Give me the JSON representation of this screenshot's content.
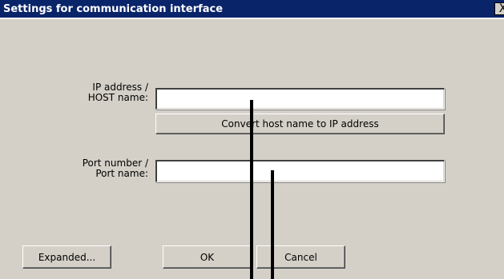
{
  "window": {
    "title": "Settings for communication interface",
    "close_glyph": "X"
  },
  "ip_field": {
    "label_line1": "IP address /",
    "label_line2": "HOST name:",
    "value": ""
  },
  "convert_button": {
    "label": "Convert host name to IP address"
  },
  "port_field": {
    "label_line1": "Port number /",
    "label_line2": "Port name:",
    "value": ""
  },
  "buttons": {
    "expanded": "Expanded...",
    "ok": "OK",
    "cancel": "Cancel"
  },
  "colors": {
    "titlebar": "#0a246a",
    "dialog_bg": "#d4d0c8"
  }
}
